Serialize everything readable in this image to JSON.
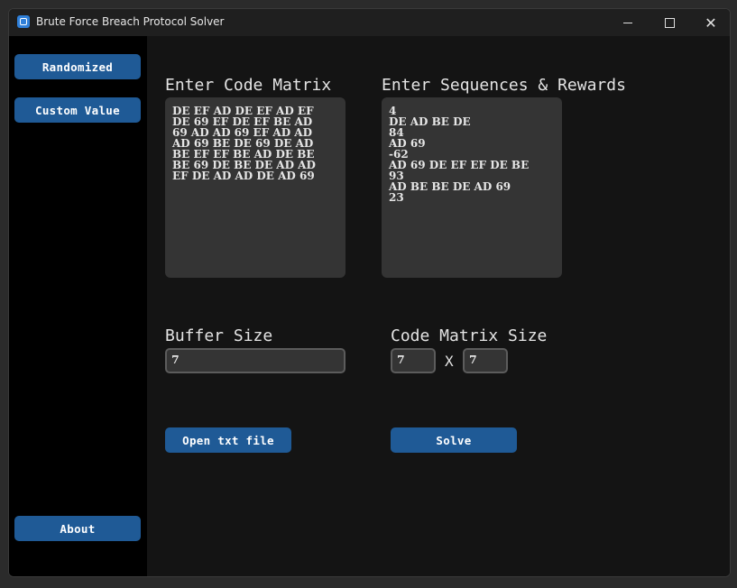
{
  "window": {
    "title": "Brute Force Breach Protocol Solver"
  },
  "sidebar": {
    "randomized_label": "Randomized",
    "custom_label": "Custom Value",
    "about_label": "About"
  },
  "main": {
    "matrix_heading": "Enter Code Matrix",
    "matrix_text": "DE EF AD DE EF AD EF\nDE 69 EF DE EF BE AD\n69 AD AD 69 EF AD AD\nAD 69 BE DE 69 DE AD\nBE EF EF BE AD DE BE\nBE 69 DE BE DE AD AD\nEF DE AD AD DE AD 69",
    "sequences_heading": "Enter Sequences & Rewards",
    "sequences_text": "4\nDE AD BE DE\n84\nAD 69\n-62\nAD 69 DE EF EF DE BE\n93\nAD BE BE DE AD 69\n23",
    "buffer_heading": "Buffer Size",
    "buffer_value": "7",
    "matrix_size_heading": "Code Matrix Size",
    "matrix_rows_value": "7",
    "matrix_x_label": "X",
    "matrix_cols_value": "7",
    "open_file_label": "Open txt file",
    "solve_label": "Solve"
  },
  "colors": {
    "button": "#1f5a96",
    "sidebar": "#000000",
    "background": "#141414",
    "textbox": "#343434"
  }
}
